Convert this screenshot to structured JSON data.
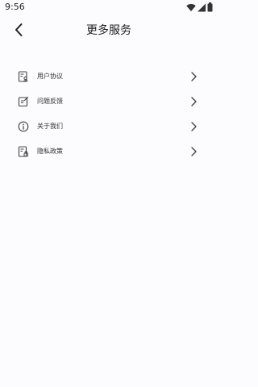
{
  "status_bar": {
    "time": "9:56",
    "icons": [
      "wifi-icon",
      "signal-icon",
      "battery-icon"
    ]
  },
  "header": {
    "title": "更多服务",
    "back_icon": "chevron-left-icon"
  },
  "menu": {
    "items": [
      {
        "label": "用户协议",
        "icon": "user-agreement-icon"
      },
      {
        "label": "问题反馈",
        "icon": "feedback-icon"
      },
      {
        "label": "关于我们",
        "icon": "info-icon"
      },
      {
        "label": "隐私政策",
        "icon": "privacy-policy-icon"
      }
    ]
  },
  "colors": {
    "background": "#fcfbfd",
    "text": "#333333"
  }
}
